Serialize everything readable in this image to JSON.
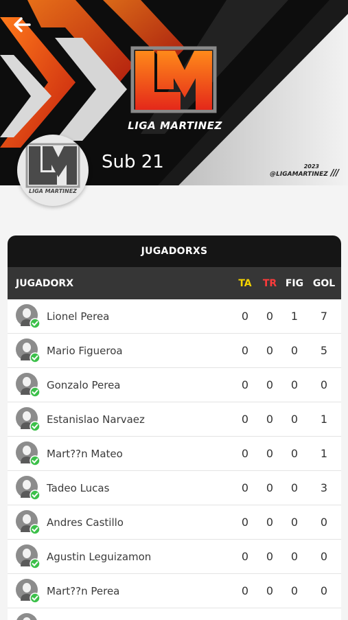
{
  "header": {
    "brand_name": "LIGA MARTINEZ",
    "handle_year": "2023",
    "handle": "@LIGAMARTINEZ",
    "handle_marks": "///",
    "team_logo_text": "LIGA MARTINEZ",
    "team_name": "Sub 21"
  },
  "table": {
    "title": "JUGADORXS",
    "columns": {
      "player": "JUGADORX",
      "ta": "TA",
      "tr": "TR",
      "fig": "FIG",
      "gol": "GOL"
    },
    "rows": [
      {
        "name": "Lionel Perea",
        "ta": "0",
        "tr": "0",
        "fig": "1",
        "gol": "7"
      },
      {
        "name": "Mario Figueroa",
        "ta": "0",
        "tr": "0",
        "fig": "0",
        "gol": "5"
      },
      {
        "name": "Gonzalo Perea",
        "ta": "0",
        "tr": "0",
        "fig": "0",
        "gol": "0"
      },
      {
        "name": "Estanislao Narvaez",
        "ta": "0",
        "tr": "0",
        "fig": "0",
        "gol": "1"
      },
      {
        "name": "Mart??n Mateo",
        "ta": "0",
        "tr": "0",
        "fig": "0",
        "gol": "1"
      },
      {
        "name": "Tadeo Lucas",
        "ta": "0",
        "tr": "0",
        "fig": "0",
        "gol": "3"
      },
      {
        "name": "Andres Castillo",
        "ta": "0",
        "tr": "0",
        "fig": "0",
        "gol": "0"
      },
      {
        "name": "Agustin Leguizamon",
        "ta": "0",
        "tr": "0",
        "fig": "0",
        "gol": "0"
      },
      {
        "name": "Mart??n Perea",
        "ta": "0",
        "tr": "0",
        "fig": "0",
        "gol": "0"
      },
      {
        "name": "",
        "ta": "",
        "tr": "",
        "fig": "",
        "gol": ""
      }
    ]
  },
  "colors": {
    "accent_orange": "#f05a1e",
    "ta_yellow": "#f5d400",
    "tr_red": "#ff3b3b",
    "check_green": "#3cc04a"
  }
}
